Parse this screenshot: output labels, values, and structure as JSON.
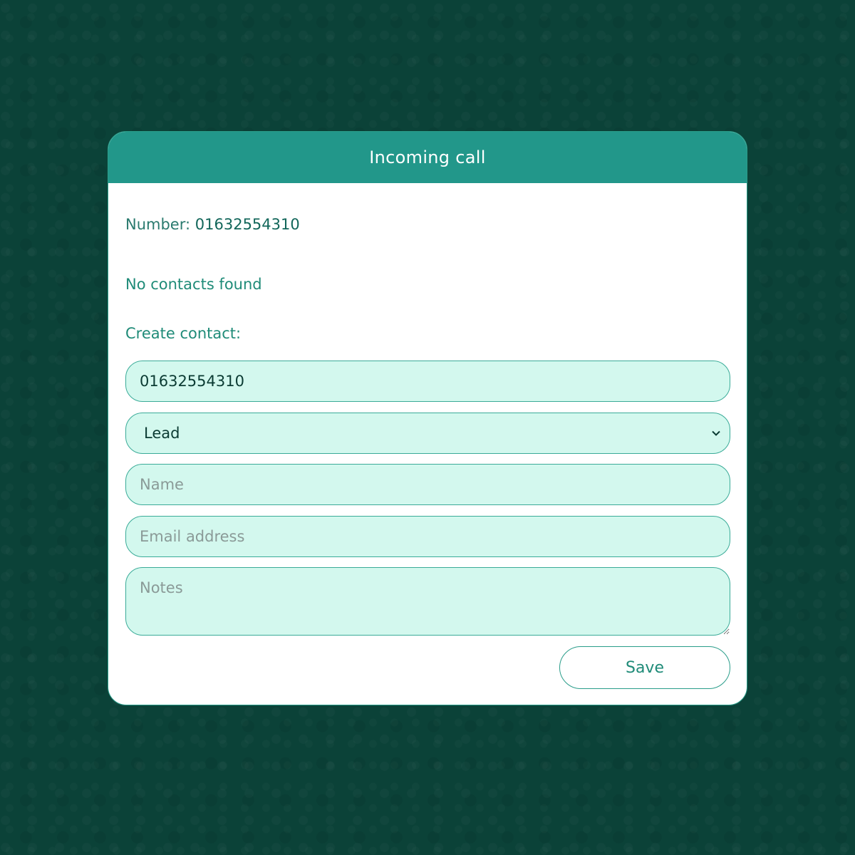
{
  "dialog": {
    "title": "Incoming call",
    "number_label": "Number:",
    "number_value": "01632554310",
    "no_contacts_text": "No contacts found",
    "create_contact_label": "Create contact:"
  },
  "form": {
    "phone_value": "01632554310",
    "type_select": {
      "selected": "Lead"
    },
    "name_placeholder": "Name",
    "email_placeholder": "Email address",
    "notes_placeholder": "Notes",
    "save_label": "Save"
  },
  "icons": {
    "dropdown": "chevron-down-icon"
  },
  "colors": {
    "background": "#0b4238",
    "header": "#22978a",
    "accent": "#1f8b78",
    "field_background": "#d3f8ee"
  }
}
